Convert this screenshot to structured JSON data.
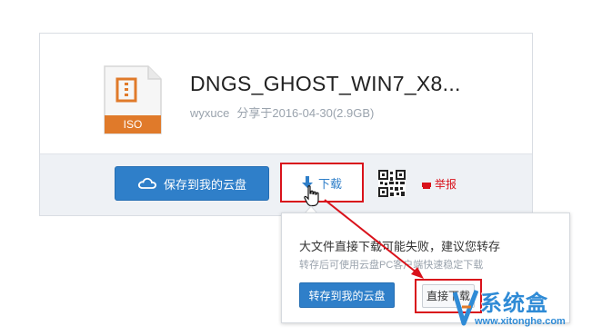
{
  "file": {
    "title": "DNGS_GHOST_WIN7_X8...",
    "owner": "wyxuce",
    "shared_info": "分享于2016-04-30(2.9GB)",
    "type_badge": "ISO",
    "icon": "zip-file-icon"
  },
  "toolbar": {
    "save_label": "保存到我的云盘",
    "download_label": "下载",
    "report_label": "举报",
    "save_icon": "cloud-icon",
    "download_icon": "download-arrow-icon",
    "qr_icon": "qr-code-icon",
    "report_icon": "flag-icon"
  },
  "popup": {
    "message": "大文件直接下载可能失败，建议您转存",
    "sub_message": "转存后可使用云盘PC客户端快速稳定下载",
    "transfer_label": "转存到我的云盘",
    "direct_label": "直接下载"
  },
  "watermark": {
    "name": "系统盒",
    "url": "www.xitonghe.com"
  },
  "colors": {
    "accent": "#2f7fc9",
    "annotation": "#d9121b",
    "badge": "#e07a2a"
  }
}
